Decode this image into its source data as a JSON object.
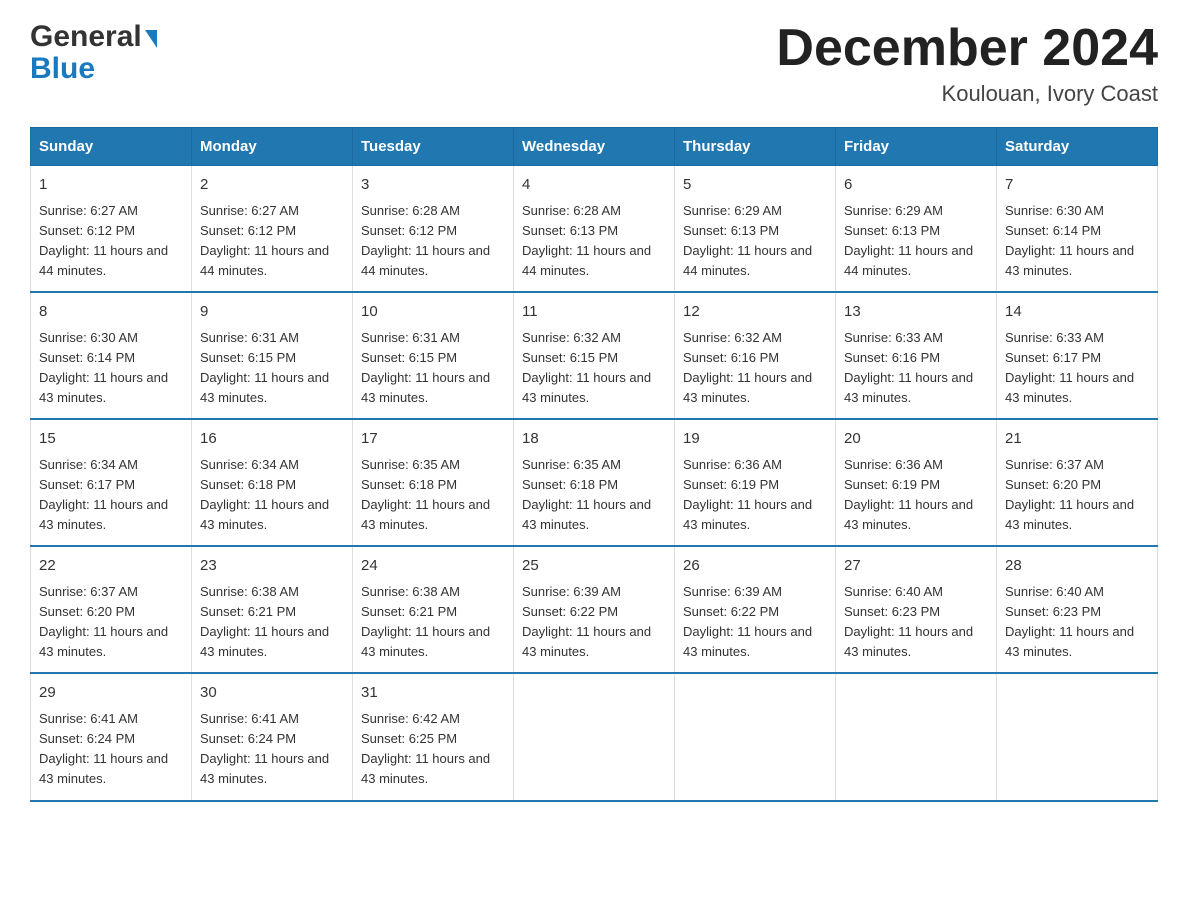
{
  "header": {
    "logo_line1": "General",
    "logo_line2": "Blue",
    "title": "December 2024",
    "location": "Koulouan, Ivory Coast"
  },
  "days_of_week": [
    "Sunday",
    "Monday",
    "Tuesday",
    "Wednesday",
    "Thursday",
    "Friday",
    "Saturday"
  ],
  "weeks": [
    [
      {
        "day": "1",
        "sunrise": "6:27 AM",
        "sunset": "6:12 PM",
        "daylight": "11 hours and 44 minutes."
      },
      {
        "day": "2",
        "sunrise": "6:27 AM",
        "sunset": "6:12 PM",
        "daylight": "11 hours and 44 minutes."
      },
      {
        "day": "3",
        "sunrise": "6:28 AM",
        "sunset": "6:12 PM",
        "daylight": "11 hours and 44 minutes."
      },
      {
        "day": "4",
        "sunrise": "6:28 AM",
        "sunset": "6:13 PM",
        "daylight": "11 hours and 44 minutes."
      },
      {
        "day": "5",
        "sunrise": "6:29 AM",
        "sunset": "6:13 PM",
        "daylight": "11 hours and 44 minutes."
      },
      {
        "day": "6",
        "sunrise": "6:29 AM",
        "sunset": "6:13 PM",
        "daylight": "11 hours and 44 minutes."
      },
      {
        "day": "7",
        "sunrise": "6:30 AM",
        "sunset": "6:14 PM",
        "daylight": "11 hours and 43 minutes."
      }
    ],
    [
      {
        "day": "8",
        "sunrise": "6:30 AM",
        "sunset": "6:14 PM",
        "daylight": "11 hours and 43 minutes."
      },
      {
        "day": "9",
        "sunrise": "6:31 AM",
        "sunset": "6:15 PM",
        "daylight": "11 hours and 43 minutes."
      },
      {
        "day": "10",
        "sunrise": "6:31 AM",
        "sunset": "6:15 PM",
        "daylight": "11 hours and 43 minutes."
      },
      {
        "day": "11",
        "sunrise": "6:32 AM",
        "sunset": "6:15 PM",
        "daylight": "11 hours and 43 minutes."
      },
      {
        "day": "12",
        "sunrise": "6:32 AM",
        "sunset": "6:16 PM",
        "daylight": "11 hours and 43 minutes."
      },
      {
        "day": "13",
        "sunrise": "6:33 AM",
        "sunset": "6:16 PM",
        "daylight": "11 hours and 43 minutes."
      },
      {
        "day": "14",
        "sunrise": "6:33 AM",
        "sunset": "6:17 PM",
        "daylight": "11 hours and 43 minutes."
      }
    ],
    [
      {
        "day": "15",
        "sunrise": "6:34 AM",
        "sunset": "6:17 PM",
        "daylight": "11 hours and 43 minutes."
      },
      {
        "day": "16",
        "sunrise": "6:34 AM",
        "sunset": "6:18 PM",
        "daylight": "11 hours and 43 minutes."
      },
      {
        "day": "17",
        "sunrise": "6:35 AM",
        "sunset": "6:18 PM",
        "daylight": "11 hours and 43 minutes."
      },
      {
        "day": "18",
        "sunrise": "6:35 AM",
        "sunset": "6:18 PM",
        "daylight": "11 hours and 43 minutes."
      },
      {
        "day": "19",
        "sunrise": "6:36 AM",
        "sunset": "6:19 PM",
        "daylight": "11 hours and 43 minutes."
      },
      {
        "day": "20",
        "sunrise": "6:36 AM",
        "sunset": "6:19 PM",
        "daylight": "11 hours and 43 minutes."
      },
      {
        "day": "21",
        "sunrise": "6:37 AM",
        "sunset": "6:20 PM",
        "daylight": "11 hours and 43 minutes."
      }
    ],
    [
      {
        "day": "22",
        "sunrise": "6:37 AM",
        "sunset": "6:20 PM",
        "daylight": "11 hours and 43 minutes."
      },
      {
        "day": "23",
        "sunrise": "6:38 AM",
        "sunset": "6:21 PM",
        "daylight": "11 hours and 43 minutes."
      },
      {
        "day": "24",
        "sunrise": "6:38 AM",
        "sunset": "6:21 PM",
        "daylight": "11 hours and 43 minutes."
      },
      {
        "day": "25",
        "sunrise": "6:39 AM",
        "sunset": "6:22 PM",
        "daylight": "11 hours and 43 minutes."
      },
      {
        "day": "26",
        "sunrise": "6:39 AM",
        "sunset": "6:22 PM",
        "daylight": "11 hours and 43 minutes."
      },
      {
        "day": "27",
        "sunrise": "6:40 AM",
        "sunset": "6:23 PM",
        "daylight": "11 hours and 43 minutes."
      },
      {
        "day": "28",
        "sunrise": "6:40 AM",
        "sunset": "6:23 PM",
        "daylight": "11 hours and 43 minutes."
      }
    ],
    [
      {
        "day": "29",
        "sunrise": "6:41 AM",
        "sunset": "6:24 PM",
        "daylight": "11 hours and 43 minutes."
      },
      {
        "day": "30",
        "sunrise": "6:41 AM",
        "sunset": "6:24 PM",
        "daylight": "11 hours and 43 minutes."
      },
      {
        "day": "31",
        "sunrise": "6:42 AM",
        "sunset": "6:25 PM",
        "daylight": "11 hours and 43 minutes."
      },
      null,
      null,
      null,
      null
    ]
  ]
}
